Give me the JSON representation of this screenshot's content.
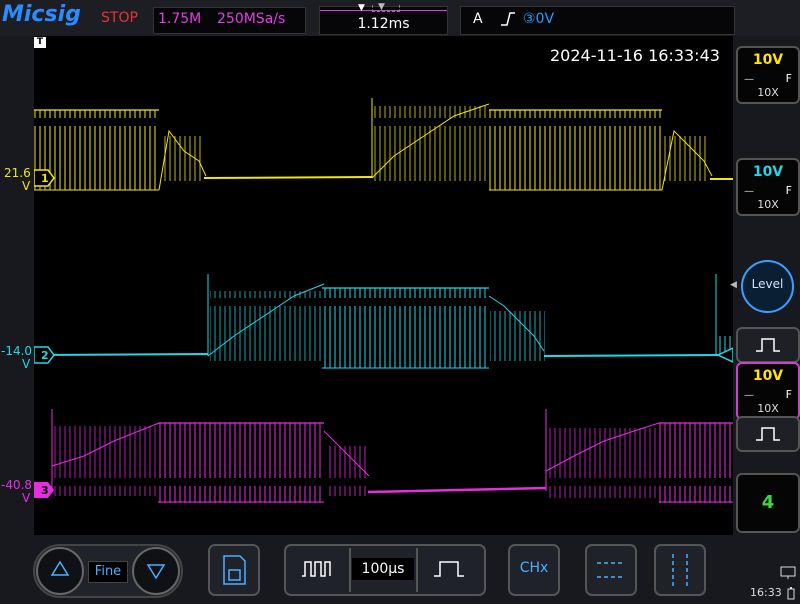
{
  "brand": {
    "logo": "Micsig",
    "run_state": "STOP"
  },
  "acquisition": {
    "memory_depth": "1.75M",
    "sample_rate": "250MSa/s"
  },
  "timebase": {
    "trigger_position": "1.12ms"
  },
  "trigger": {
    "mode": "A",
    "source": "③0V",
    "edge_icon": "rising-edge-icon"
  },
  "datetime": "2024-11-16 16:33:43",
  "channels": [
    {
      "id": "1",
      "offset_label": "21.6",
      "unit": "V",
      "color": "#f0e516",
      "scale": "10V",
      "coupling_icon": "dc-coupling-icon",
      "bw": "F",
      "probe": "10X"
    },
    {
      "id": "2",
      "offset_label": "-14.0",
      "unit": "V",
      "color": "#22d8e6",
      "scale": "10V",
      "coupling_icon": "dc-coupling-icon",
      "bw": "F",
      "probe": "10X"
    },
    {
      "id": "3",
      "offset_label": "-40.8",
      "unit": "V",
      "color": "#e62ee0",
      "scale": "10V",
      "coupling_icon": "dc-coupling-icon",
      "bw": "F",
      "probe": "10X"
    }
  ],
  "right_panel": {
    "level_label": "Level",
    "channel_count": "4"
  },
  "bottom": {
    "fine_label": "Fine",
    "timebase_label": "100μs",
    "chx_label": "CHx"
  },
  "status": {
    "clock": "16:33"
  }
}
